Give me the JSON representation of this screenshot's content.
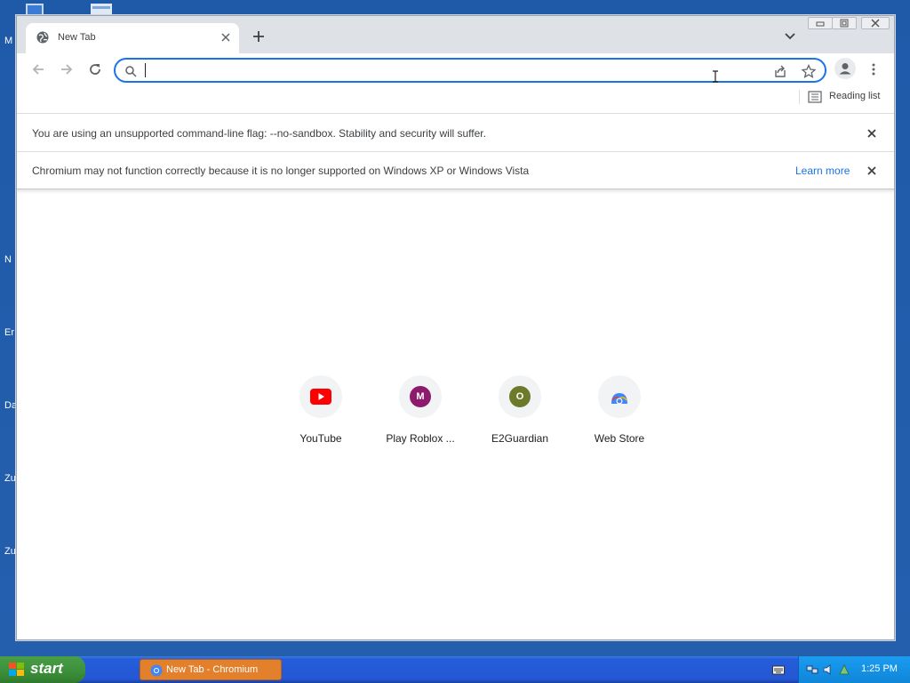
{
  "desktop": {
    "icon_labels": [
      "M",
      "N",
      "Er",
      "Da",
      "Zu",
      "Zu"
    ]
  },
  "tab": {
    "title": "New Tab"
  },
  "omnibox": {
    "value": "",
    "placeholder": ""
  },
  "bookmark_bar": {
    "reading_list_label": "Reading list"
  },
  "infobars": [
    {
      "message": "You are using an unsupported command-line flag: --no-sandbox. Stability and security will suffer."
    },
    {
      "message": "Chromium may not function correctly because it is no longer supported on Windows XP or Windows Vista",
      "link": "Learn more"
    }
  ],
  "shortcuts": [
    {
      "label": "YouTube",
      "letter": "",
      "color": "#ff0000"
    },
    {
      "label": "Play Roblox ...",
      "letter": "M",
      "color": "#8e1a6e"
    },
    {
      "label": "E2Guardian",
      "letter": "O",
      "color": "#6d7a2a"
    },
    {
      "label": "Web Store",
      "letter": "",
      "color": "#4285f4"
    }
  ],
  "taskbar": {
    "start_label": "start",
    "task_label": "New Tab - Chromium",
    "clock": "1:25 PM"
  },
  "colors": {
    "accent": "#1a73e8",
    "desktop": "#245fae",
    "taskbar": "#2457d3",
    "start": "#3c8f3a"
  }
}
